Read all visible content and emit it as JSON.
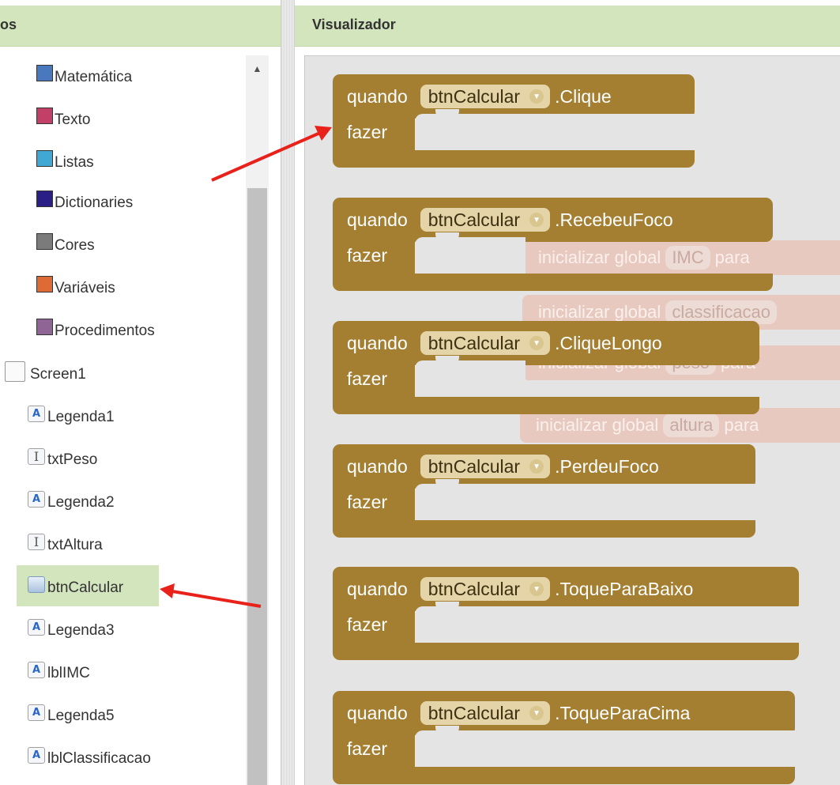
{
  "left_panel": {
    "header_title": "os",
    "builtin": [
      {
        "label": "Matemática",
        "color": "#4a78bf"
      },
      {
        "label": "Texto",
        "color": "#c24068"
      },
      {
        "label": "Listas",
        "color": "#41a7d3"
      },
      {
        "label": "Dictionaries",
        "color": "#2a1f86"
      },
      {
        "label": "Cores",
        "color": "#7b7b7b"
      },
      {
        "label": "Variáveis",
        "color": "#de6b35"
      },
      {
        "label": "Procedimentos",
        "color": "#8f6596"
      }
    ],
    "screen_label": "Screen1",
    "components": [
      {
        "label": "Legenda1",
        "icon": "label-icon"
      },
      {
        "label": "txtPeso",
        "icon": "textbox-icon"
      },
      {
        "label": "Legenda2",
        "icon": "label-icon"
      },
      {
        "label": "txtAltura",
        "icon": "textbox-icon"
      },
      {
        "label": "btnCalcular",
        "icon": "button-icon"
      },
      {
        "label": "Legenda3",
        "icon": "label-icon"
      },
      {
        "label": "lblIMC",
        "icon": "label-icon"
      },
      {
        "label": "Legenda5",
        "icon": "label-icon"
      },
      {
        "label": "lblClassificacao",
        "icon": "label-icon"
      }
    ],
    "selected_component": "btnCalcular"
  },
  "viewer": {
    "header_title": "Visualizador",
    "block_color": "#a57f31",
    "events": [
      {
        "when": "quando",
        "component": "btnCalcular",
        "event": ".Clique",
        "do": "fazer"
      },
      {
        "when": "quando",
        "component": "btnCalcular",
        "event": ".RecebeuFoco",
        "do": "fazer"
      },
      {
        "when": "quando",
        "component": "btnCalcular",
        "event": ".CliqueLongo",
        "do": "fazer"
      },
      {
        "when": "quando",
        "component": "btnCalcular",
        "event": ".PerdeuFoco",
        "do": "fazer"
      },
      {
        "when": "quando",
        "component": "btnCalcular",
        "event": ".ToqueParaBaixo",
        "do": "fazer"
      },
      {
        "when": "quando",
        "component": "btnCalcular",
        "event": ".ToqueParaCima",
        "do": "fazer"
      }
    ],
    "ghost_blocks": [
      {
        "prefix": "inicializar global",
        "var": "IMC",
        "suffix": "para"
      },
      {
        "prefix": "inicializar global",
        "var": "classificacao",
        "suffix": ""
      },
      {
        "prefix": "inicializar global",
        "var": "peso",
        "suffix": "para"
      },
      {
        "prefix": "inicializar global",
        "var": "altura",
        "suffix": "para"
      }
    ],
    "arrow_color": "#e8221b"
  }
}
